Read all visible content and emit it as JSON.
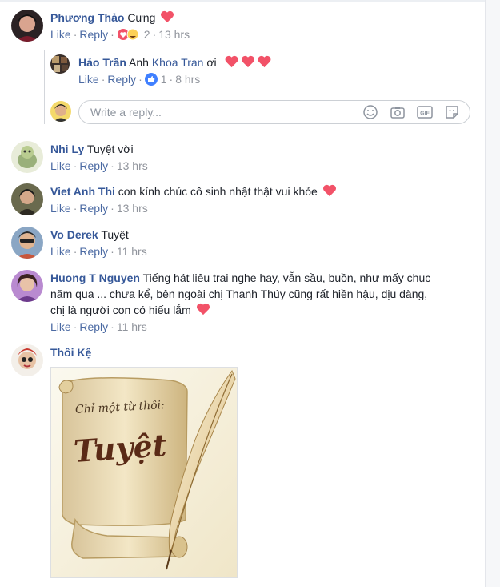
{
  "comments": [
    {
      "name": "Phương Thảo",
      "text": "Cưng",
      "like": "Like",
      "reply": "Reply",
      "reaction_count": "2",
      "time": "13 hrs"
    },
    {
      "name": "Nhi Ly",
      "text": "Tuyệt vời",
      "like": "Like",
      "reply": "Reply",
      "time": "13 hrs"
    },
    {
      "name": "Viet Anh Thi",
      "text": "con kính chúc cô sinh nhật thật vui khỏe",
      "like": "Like",
      "reply": "Reply",
      "time": "13 hrs"
    },
    {
      "name": "Vo Derek",
      "text": "Tuyệt",
      "like": "Like",
      "reply": "Reply",
      "time": "11 hrs"
    },
    {
      "name": "Huong T Nguyen",
      "text_line1": "Tiếng hát liêu trai nghe hay, vẫn sầu, buồn, như mấy chục",
      "text_line2": "năm qua ... chưa kể, bên ngoài chị Thanh Thúy cũng rất hiền hậu, dịu dàng,",
      "text_line3": "chị là người con có hiếu lắm",
      "like": "Like",
      "reply": "Reply",
      "time": "11 hrs"
    },
    {
      "name": "Thôi Kệ",
      "image_caption_1": "Chỉ một từ thôi:",
      "image_caption_2": "Tuyệt"
    }
  ],
  "reply": {
    "name": "Hảo Trần",
    "text_before": "Anh",
    "mention": "Khoa Tran",
    "text_after": "ơi",
    "like": "Like",
    "reply": "Reply",
    "reaction_count": "1",
    "time": "8 hrs"
  },
  "composer": {
    "placeholder": "Write a reply...",
    "icons": [
      "emoji-icon",
      "camera-icon",
      "gif-icon",
      "sticker-icon"
    ]
  },
  "colors": {
    "link": "#365899",
    "meta": "#90949c",
    "heart": "#f25268"
  }
}
